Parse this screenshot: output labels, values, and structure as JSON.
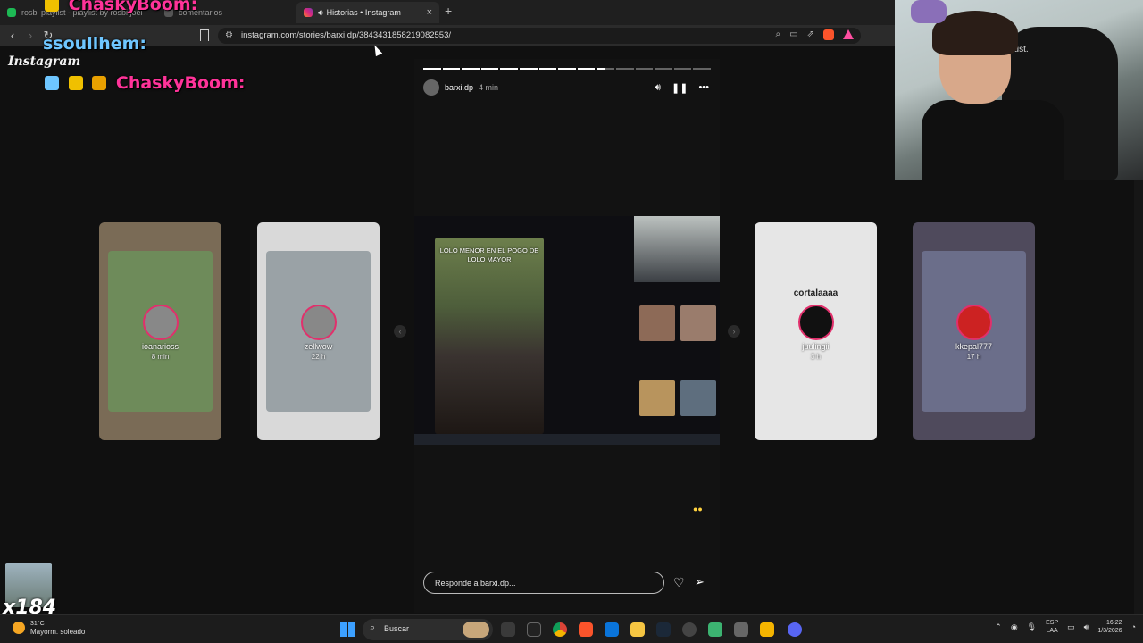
{
  "browser": {
    "tabs": [
      {
        "label": "rosbi playlist - playlist by rosbi joel",
        "active": false
      },
      {
        "label": "comentarios",
        "active": false
      },
      {
        "label": "Historias • Instagram",
        "active": true
      }
    ],
    "url": "instagram.com/stories/barxi.dp/3843431858219082553/",
    "new_tab": "+",
    "close_glyph": "×"
  },
  "overlay": {
    "chat": [
      {
        "user": "ChaskyBoom:",
        "color": "#ff3399"
      },
      {
        "user": "ssoullhem:",
        "color": "#6ec6ff"
      },
      {
        "user": "ChaskyBoom:",
        "color": "#ff3399"
      }
    ],
    "instagram_script": "Instagram",
    "webcam_brand": "GXTrust.",
    "counter": "x184"
  },
  "story": {
    "username": "barxi.dp",
    "time": "4 min",
    "progress": [
      1,
      1,
      1,
      1,
      1,
      1,
      1,
      1,
      1,
      0.5,
      0,
      0,
      0,
      0,
      0
    ],
    "video_caption": "LOLO MENOR EN EL POGO DE LOLO MAYOR",
    "reply_placeholder": "Responde a barxi.dp..."
  },
  "thumbs": [
    {
      "user": "ioanarioss",
      "ago": "8 min",
      "bg": "#7a6b56",
      "inner": "#6e8b5a"
    },
    {
      "user": "zellwow",
      "ago": "22 h",
      "bg": "#d9d9d9",
      "inner": "#9aa2a6"
    },
    {
      "user": "juulingii",
      "ago": "3 h",
      "bg": "#e6e6e6",
      "inner": "transparent",
      "title": "cortalaaaa"
    },
    {
      "user": "kkepal777",
      "ago": "17 h",
      "bg": "#4f4a5c",
      "inner": "#6b6e8a"
    }
  ],
  "taskbar": {
    "temp": "31°C",
    "weather": "Mayorm. soleado",
    "search": "Buscar",
    "lang1": "ESP",
    "lang2": "LAA",
    "time": "16:22",
    "date": "1/3/2026"
  }
}
